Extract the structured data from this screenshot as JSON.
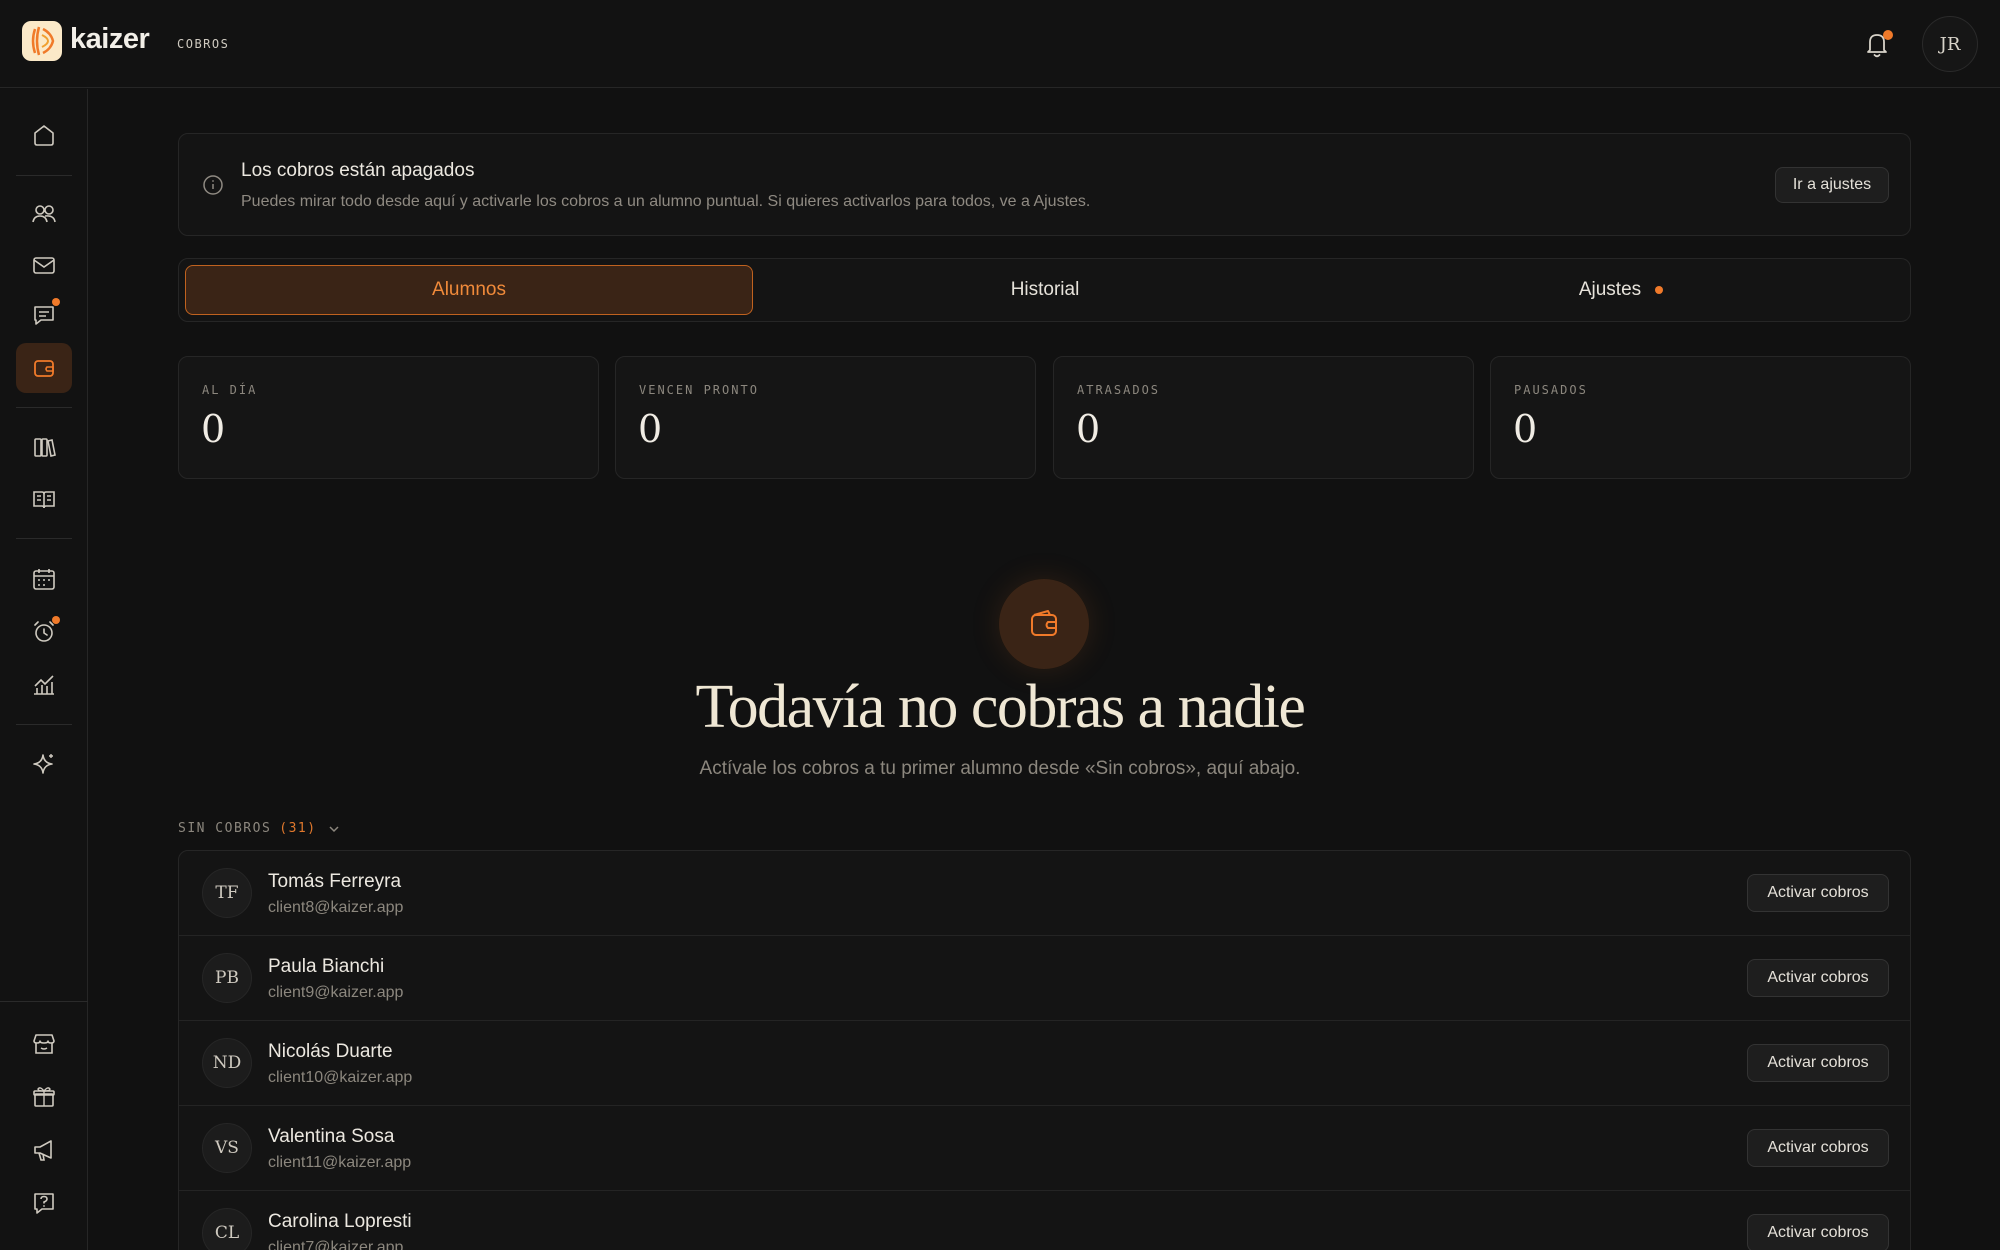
{
  "header": {
    "brand": "kaizer",
    "section": "COBROS",
    "user_initials": "JR"
  },
  "banner": {
    "title": "Los cobros están apagados",
    "text": "Puedes mirar todo desde aquí y activarle los cobros a un alumno puntual. Si quieres activarlos para todos, ve a Ajustes.",
    "button": "Ir a ajustes"
  },
  "tabs": [
    {
      "label": "Alumnos",
      "active": true
    },
    {
      "label": "Historial",
      "active": false
    },
    {
      "label": "Ajustes",
      "active": false
    }
  ],
  "stats": [
    {
      "label": "AL DÍA",
      "value": "0"
    },
    {
      "label": "VENCEN PRONTO",
      "value": "0"
    },
    {
      "label": "ATRASADOS",
      "value": "0"
    },
    {
      "label": "PAUSADOS",
      "value": "0"
    }
  ],
  "empty_state": {
    "title": "Todavía no cobras a nadie",
    "subtitle": "Actívale los cobros a tu primer alumno desde «Sin cobros», aquí abajo."
  },
  "group": {
    "label": "SIN COBROS",
    "count": "(31)"
  },
  "clients": [
    {
      "initials": "TF",
      "name": "Tomás Ferreyra",
      "email": "client8@kaizer.app",
      "action": "Activar cobros"
    },
    {
      "initials": "PB",
      "name": "Paula Bianchi",
      "email": "client9@kaizer.app",
      "action": "Activar cobros"
    },
    {
      "initials": "ND",
      "name": "Nicolás Duarte",
      "email": "client10@kaizer.app",
      "action": "Activar cobros"
    },
    {
      "initials": "VS",
      "name": "Valentina Sosa",
      "email": "client11@kaizer.app",
      "action": "Activar cobros"
    },
    {
      "initials": "CL",
      "name": "Carolina Lopresti",
      "email": "client7@kaizer.app",
      "action": "Activar cobros"
    }
  ],
  "colors": {
    "accent": "#f07a2a",
    "background": "#111111",
    "active_fill": "#3a2416"
  },
  "sidebar_icons": [
    "home-icon",
    "users-icon",
    "mail-icon",
    "chat-icon",
    "wallet-icon",
    "library-icon",
    "book-icon",
    "calendar-icon",
    "alarm-icon",
    "chart-icon",
    "sparkle-icon",
    "store-icon",
    "gift-icon",
    "megaphone-icon",
    "help-icon"
  ]
}
